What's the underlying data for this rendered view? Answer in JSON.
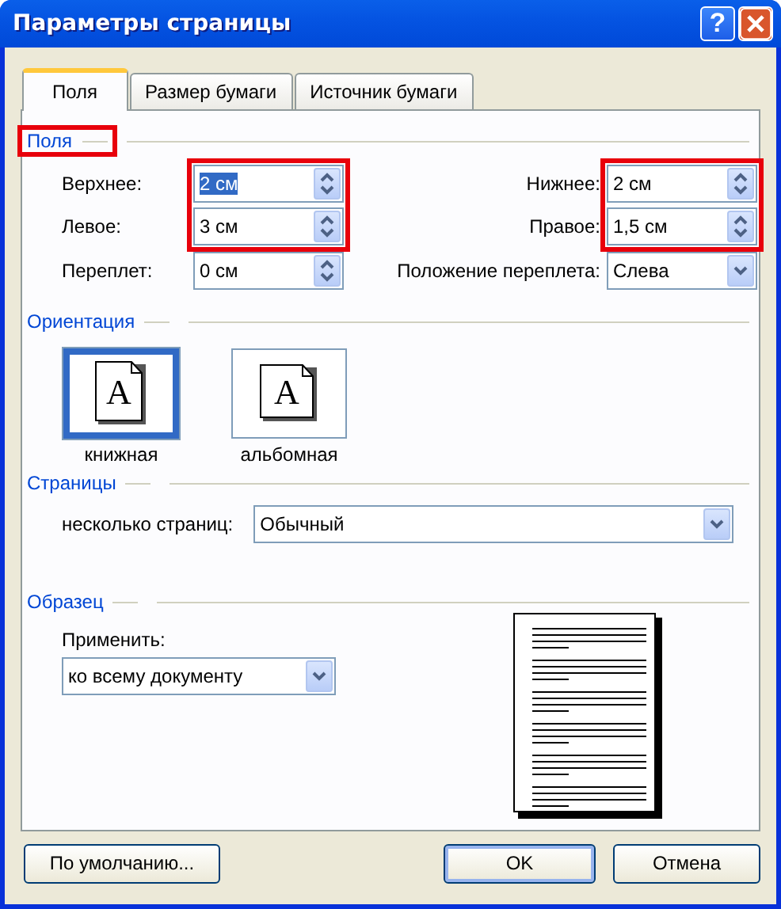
{
  "window": {
    "title": "Параметры страницы",
    "help_button": "?"
  },
  "tabs": [
    {
      "label": "Поля",
      "selected": true
    },
    {
      "label": "Размер бумаги",
      "selected": false
    },
    {
      "label": "Источник бумаги",
      "selected": false
    }
  ],
  "margins": {
    "heading": {
      "label": "Поля",
      "highlighted": true
    },
    "columns": [
      {
        "groups": [
          {
            "highlighted": true,
            "fields": [
              {
                "kind": "spin",
                "label": "Верхнее:",
                "value": "2 см",
                "text_selected": true
              },
              {
                "kind": "spin",
                "label": "Левое:",
                "value": "3 см",
                "text_selected": false
              }
            ]
          },
          {
            "highlighted": false,
            "fields": [
              {
                "kind": "spin",
                "label": "Переплет:",
                "value": "0 см",
                "text_selected": false
              }
            ]
          }
        ]
      },
      {
        "groups": [
          {
            "highlighted": true,
            "fields": [
              {
                "kind": "spin",
                "label": "Нижнее:",
                "value": "2 см",
                "text_selected": false
              },
              {
                "kind": "spin",
                "label": "Правое:",
                "value": "1,5 см",
                "text_selected": false
              }
            ]
          },
          {
            "highlighted": false,
            "fields": [
              {
                "kind": "dropdown",
                "label": "Положение переплета:",
                "value": "Слева",
                "text_selected": false
              }
            ]
          }
        ]
      }
    ]
  },
  "orientation": {
    "heading": {
      "label": "Ориентация",
      "highlighted": false
    },
    "options": [
      {
        "kind": "portrait",
        "glyph": "A",
        "label": "книжная",
        "selected": true
      },
      {
        "kind": "landscape",
        "glyph": "A",
        "label": "альбомная",
        "selected": false
      }
    ]
  },
  "pages": {
    "heading": {
      "label": "Страницы",
      "highlighted": false
    },
    "label": "несколько страниц:",
    "value": "Обычный"
  },
  "sample": {
    "heading": {
      "label": "Образец",
      "highlighted": false
    },
    "apply_label": "Применить:",
    "apply_value": "ко всему документу"
  },
  "buttons": [
    {
      "label": "По умолчанию...",
      "default": false
    },
    {
      "label": "OK",
      "default": true
    },
    {
      "label": "Отмена",
      "default": false
    }
  ]
}
